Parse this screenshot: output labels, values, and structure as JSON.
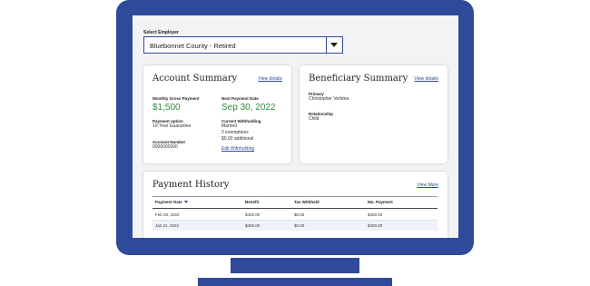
{
  "employer": {
    "label": "Select Employer",
    "selected": "Bluebonnet County - Retired"
  },
  "account_summary": {
    "title": "Account Summary",
    "link": "View details",
    "gross_label": "Monthly Gross Payment",
    "gross_value": "$1,500",
    "next_label": "Next Payment Date",
    "next_value": "Sep 30, 2022",
    "option_label": "Payment option",
    "option_value": "10-Year Guarantee",
    "withholding_label": "Current Withholding",
    "withholding_lines": [
      "Married",
      "2 exemptions",
      "$0.00 additional"
    ],
    "edit_link": "Edit Withholding",
    "account_label": "Account Number",
    "account_value": "0000000000"
  },
  "beneficiary_summary": {
    "title": "Beneficiary Summary",
    "link": "View details",
    "primary_label": "Primary",
    "primary_value": "Christopher Verbina",
    "relationship_label": "Relationship",
    "relationship_value": "Child"
  },
  "payment_history": {
    "title": "Payment History",
    "link": "View More",
    "columns": [
      "Payment Date",
      "Benefit",
      "Tax Withheld",
      "Mo. Payment"
    ],
    "rows": [
      [
        "Feb 28, 2022",
        "$400.00",
        "$0.00",
        "$400.00"
      ],
      [
        "Jan 31, 2022",
        "$400.00",
        "$0.00",
        "$400.00"
      ]
    ]
  },
  "colors": {
    "frame": "#2f4a99",
    "accent_green": "#2e8b3e",
    "link": "#2f4a99"
  }
}
